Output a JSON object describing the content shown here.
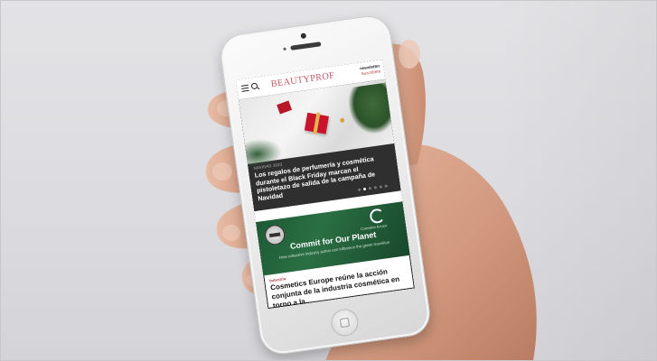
{
  "phone_screen": {
    "header": {
      "logo": "BEAUTYPROF",
      "newsletter_link": "newsletter",
      "subscribe_link": "Suscríbete"
    },
    "hero": {
      "tag": "NAVIDAD 2023",
      "title": "Los regalos de perfumería y cosmética durante el Black Friday marcan el pistoletazo de salida de la campaña de Navidad",
      "carousel_dots": 6,
      "active_dot": 1
    },
    "banner": {
      "logo_label": "Cosmetics Europe",
      "title": "Commit for Our Planet",
      "subtitle": "How collective industry action can influence the green transition"
    },
    "article": {
      "tag": "Industria",
      "title": "Cosmetics Europe reúne la acción conjunta de la industria cosmética en torno a la..."
    }
  },
  "colors": {
    "brand_logo": "#c45a68",
    "banner_green": "#2b6f44",
    "hero_dark": "#2f2f2f",
    "accent_red": "#c8152b"
  }
}
